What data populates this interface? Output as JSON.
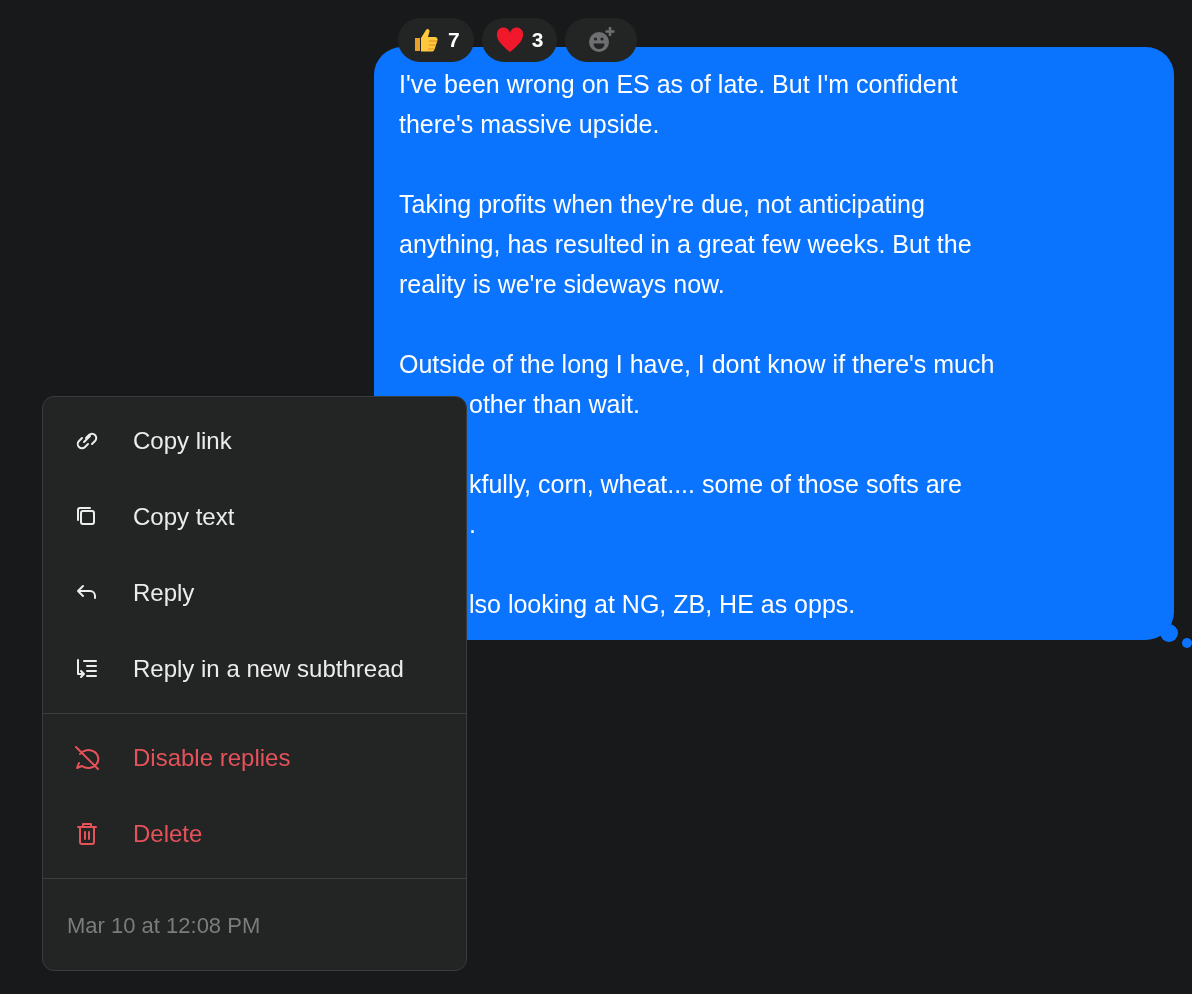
{
  "reactions": [
    {
      "kind": "thumbs_up",
      "count": "7"
    },
    {
      "kind": "heart",
      "count": "3"
    },
    {
      "kind": "add"
    }
  ],
  "message": {
    "paragraphs": [
      [
        {
          "text": "I've been wrong on ES as of late. But I'm confident"
        },
        {
          "text": "there's massive upside."
        }
      ],
      [
        {
          "text": "Taking profits when they're due, not anticipating"
        },
        {
          "text": "anything, has resulted in a great few weeks. But the"
        },
        {
          "text": "reality is we're sideways now."
        }
      ],
      [
        {
          "text": "Outside of the long I have, I dont know if there's much"
        },
        {
          "text": "other than wait.",
          "covered": true
        }
      ],
      [
        {
          "text": "kfully, corn, wheat.... some of those softs are",
          "covered": true
        },
        {
          "text": ".",
          "covered": true
        }
      ],
      [
        {
          "text": "lso looking at NG, ZB, HE as opps.",
          "covered": true
        }
      ]
    ]
  },
  "menu": {
    "groups": [
      [
        {
          "label": "Copy link",
          "kind": "link",
          "danger": false
        },
        {
          "label": "Copy text",
          "kind": "copy",
          "danger": false
        },
        {
          "label": "Reply",
          "kind": "reply",
          "danger": false
        },
        {
          "label": "Reply in a new subthread",
          "kind": "subthread",
          "danger": false
        }
      ],
      [
        {
          "label": "Disable replies",
          "kind": "disable",
          "danger": true
        },
        {
          "label": "Delete",
          "kind": "delete",
          "danger": true
        }
      ]
    ],
    "timestamp": "Mar 10 at 12:08 PM"
  }
}
